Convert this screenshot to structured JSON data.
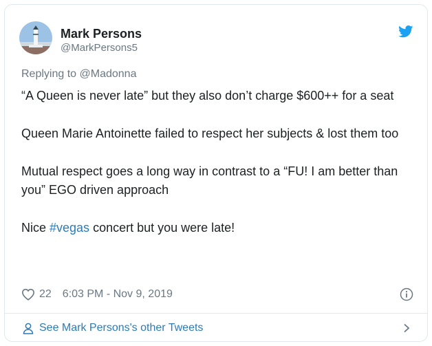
{
  "user": {
    "name": "Mark Persons",
    "handle": "@MarkPersons5"
  },
  "reply": {
    "prefix": "Replying to",
    "target": "@Madonna"
  },
  "tweet": {
    "p1": "“A Queen is never late” but they also don’t charge $600++ for a seat",
    "p2": "Queen Marie Antoinette failed to respect her subjects & lost them too",
    "p3": "Mutual respect goes a long way in contrast to a “FU! I am better than you” EGO driven approach",
    "p4_before": "Nice ",
    "p4_hashtag": "#vegas",
    "p4_after": " concert but you were late!"
  },
  "meta": {
    "likes": "22",
    "timestamp": "6:03 PM - Nov 9, 2019"
  },
  "footer": {
    "label": "See Mark Persons's other Tweets"
  },
  "icons": {
    "brand": "twitter-bird-icon",
    "like": "heart-icon",
    "info": "info-icon",
    "profile": "person-icon",
    "next": "chevron-right-icon"
  },
  "colors": {
    "brand": "#1da1f2",
    "link": "#2b7bb9",
    "muted": "#697882",
    "text": "#1c2022",
    "border": "#e1e8ed"
  }
}
